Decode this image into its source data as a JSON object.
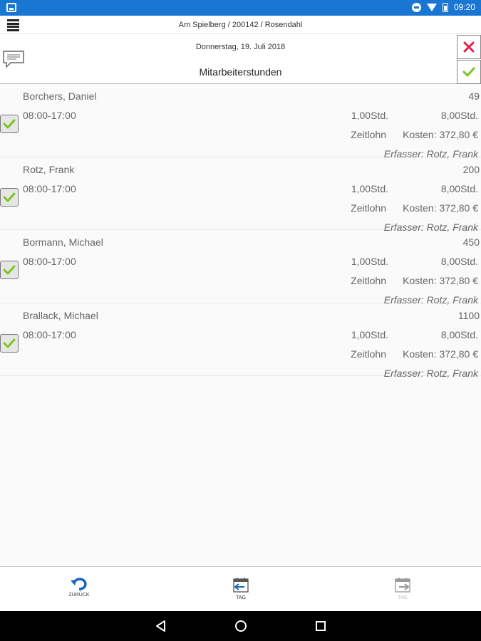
{
  "statusbar": {
    "time": "09:20"
  },
  "topbar": {
    "breadcrumb": "Am Spielberg / 200142 / Rosendahl"
  },
  "header": {
    "date": "Donnerstag, 19. Juli 2018",
    "title": "Mitarbeiterstunden"
  },
  "entries": [
    {
      "name": "Borchers, Daniel",
      "number": "49",
      "time": "08:00-17:00",
      "hours_1": "1,00Std.",
      "hours_2": "8,00Std.",
      "wage_type": "Zeitlohn",
      "cost": "Kosten: 372,80 €",
      "recorder": "Erfasser: Rotz, Frank"
    },
    {
      "name": "Rotz, Frank",
      "number": "200",
      "time": "08:00-17:00",
      "hours_1": "1,00Std.",
      "hours_2": "8,00Std.",
      "wage_type": "Zeitlohn",
      "cost": "Kosten: 372,80 €",
      "recorder": "Erfasser: Rotz, Frank"
    },
    {
      "name": "Bormann, Michael",
      "number": "450",
      "time": "08:00-17:00",
      "hours_1": "1,00Std.",
      "hours_2": "8,00Std.",
      "wage_type": "Zeitlohn",
      "cost": "Kosten: 372,80 €",
      "recorder": "Erfasser: Rotz, Frank"
    },
    {
      "name": "Brallack, Michael",
      "number": "1100",
      "time": "08:00-17:00",
      "hours_1": "1,00Std.",
      "hours_2": "8,00Std.",
      "wage_type": "Zeitlohn",
      "cost": "Kosten: 372,80 €",
      "recorder": "Erfasser: Rotz, Frank"
    }
  ],
  "bottom_nav": {
    "back_label": "ZURÜCK",
    "prev_day_label": "TAG",
    "next_day_label": "TAG"
  },
  "colors": {
    "statusbar": "#1976d2",
    "accept_green": "#7cc41f",
    "cancel_red": "#e0204a",
    "nav_blue": "#1565c0"
  },
  "icons": [
    "menu-icon",
    "comment-icon",
    "close-icon",
    "check-icon",
    "undo-icon",
    "calendar-prev-icon",
    "calendar-next-icon"
  ]
}
